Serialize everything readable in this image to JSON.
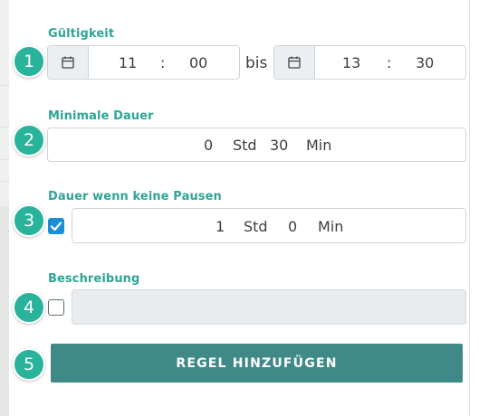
{
  "steps": [
    "1",
    "2",
    "3",
    "4",
    "5"
  ],
  "validity": {
    "label": "Gültigkeit",
    "from": {
      "hours": "11",
      "minutes": "00"
    },
    "separator": ":",
    "bis": "bis",
    "to": {
      "hours": "13",
      "minutes": "30"
    }
  },
  "min_duration": {
    "label": "Minimale Dauer",
    "hours": "0",
    "hours_unit": "Std",
    "minutes": "30",
    "minutes_unit": "Min"
  },
  "no_break_duration": {
    "label": "Dauer wenn keine Pausen",
    "checked": true,
    "hours": "1",
    "hours_unit": "Std",
    "minutes": "0",
    "minutes_unit": "Min"
  },
  "description": {
    "label": "Beschreibung",
    "checked": false,
    "value": ""
  },
  "submit_label": "REGEL HINZUFÜGEN",
  "colors": {
    "label": "#2fa596",
    "badge": "#28b39a",
    "button": "#3f8a88",
    "checkbox": "#1a8fd6"
  },
  "icons": {
    "calendar": "calendar-icon",
    "check": "check-icon"
  }
}
